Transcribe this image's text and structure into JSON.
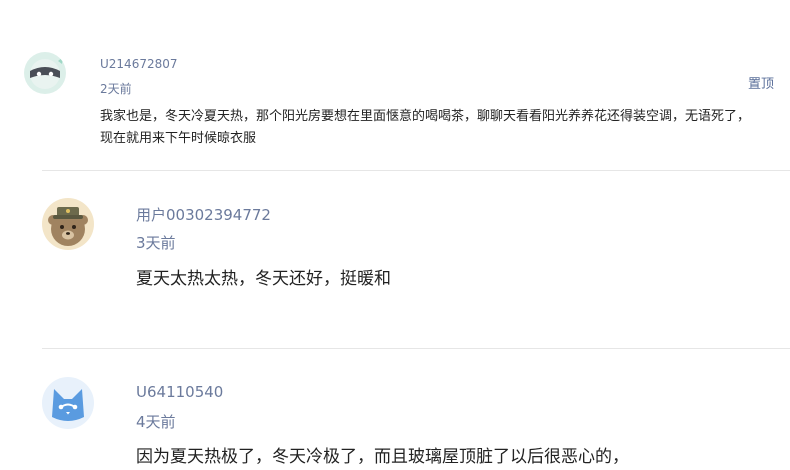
{
  "comments": [
    {
      "username": "U214672807",
      "time": "2天前",
      "content": "我家也是，冬天冷夏天热，那个阳光房要想在里面惬意的喝喝茶，聊聊天看看阳光养养花还得装空调，无语死了，现在就用来下午时候晾衣服",
      "pin_label": "置顶",
      "avatar_icon": "masked-face-icon"
    },
    {
      "username": "用户00302394772",
      "time": "3天前",
      "content": "夏天太热太热，冬天还好，挺暖和",
      "avatar_icon": "bear-with-hat-icon"
    },
    {
      "username": "U64110540",
      "time": "4天前",
      "content": "因为夏天热极了，冬天冷极了，而且玻璃屋顶脏了以后很恶心的，",
      "avatar_icon": "blue-cat-icon"
    }
  ],
  "colors": {
    "username": "#6b7a9c",
    "content": "#222222",
    "divider": "#e6e6e6"
  }
}
